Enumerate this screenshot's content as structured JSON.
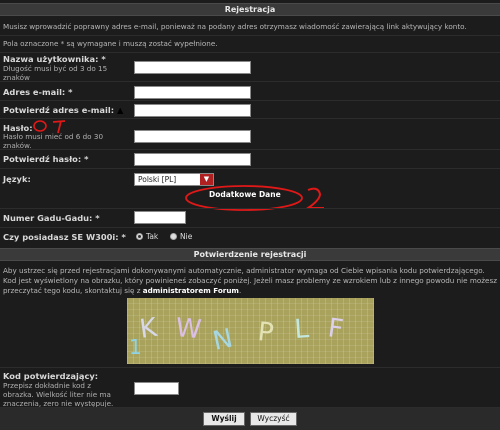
{
  "form": {
    "title": "Rejestracja",
    "info_line1": "Musisz wprowadzić poprawny adres e-mail, ponieważ na podany adres otrzymasz wiadomość zawierającą link aktywujący konto.",
    "info_line2": "Pola oznaczone * są wymagane i muszą zostać wypełnione.",
    "username_label": "Nazwa użytkownika:",
    "username_hint": "Długość musi być od 3 do 15 znaków",
    "email_label": "Adres e-mail:",
    "email_confirm_label": "Potwierdź adres e-mail:",
    "password_label": "Hasło:",
    "password_hint": "Hasło musi mieć od 6 do 30 znaków.",
    "password_confirm_label": "Potwierdź hasło:",
    "language_label": "Język:",
    "language_value": "Polski [PL]",
    "extra_data_label": "Dodatkowe Dane",
    "gg_label": "Numer Gadu-Gadu:",
    "w300i_label": "Czy posiadasz SE W300i:",
    "radio_yes": "Tak",
    "radio_no": "Nie",
    "required_mark": "*"
  },
  "confirm": {
    "title": "Potwierdzenie rejestracji",
    "info": "Aby ustrzec się przed rejestracjami dokonywanymi automatycznie, administrator wymaga od Ciebie wpisania kodu potwierdzającego. Kod jest wyświetlony na obrazku, który powinieneś zobaczyć poniżej. Jeżeli masz problemy ze wzrokiem lub z innego powodu nie możesz przeczytać tego kodu, skontaktuj się z",
    "info_link": "administratorem Forum",
    "code_label": "Kod potwierdzający:",
    "code_hint": "Przepisz dokładnie kod z obrazka. Wielkość liter nie ma znaczenia, zero nie występuje.",
    "captcha_text": "KWNPLF",
    "captcha_digit": "1"
  },
  "buttons": {
    "submit": "Wyślij",
    "reset": "Wyczyść"
  },
  "annotations": {
    "mark1": "1",
    "mark2": "2"
  }
}
